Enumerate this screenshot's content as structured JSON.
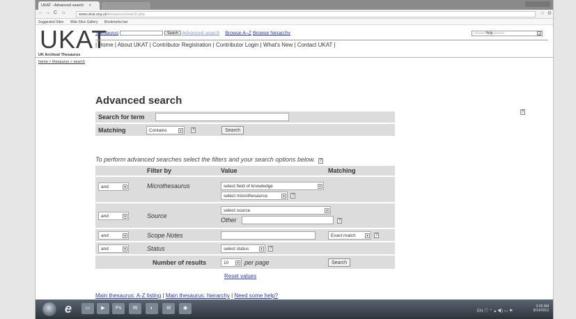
{
  "browser": {
    "tab_title": "UKAT - Advanced search",
    "tab_close": "×",
    "url_host": "www.ukat.org.uk",
    "url_path": "/thesaurus/search.php",
    "bookmarks": [
      "Suggested Sites",
      "Web Slice Gallery",
      "Bookmarks bar"
    ]
  },
  "header": {
    "logo": "UKAT",
    "logo_subtitle": "UK Archival Thesaurus",
    "thesaurus_link": "Thesaurus",
    "search_button": "Search",
    "advanced_link": "Advanced search",
    "browse_az": "Browse A–Z",
    "browse_hierarchy": "Browse hierarchy",
    "help_select": "——— Help ———",
    "menu": "| Home | About UKAT | Contributor Registration | Contributor Login | What's New | Contact UKAT |"
  },
  "breadcrumb": "home > thesaurus > search",
  "page": {
    "title": "Advanced search",
    "search_for_term_label": "Search for term",
    "matching_label": "Matching",
    "matching_value": "Contains",
    "search_button": "Search",
    "instruction": "To perform advanced searches select the filters and your search options below."
  },
  "table": {
    "headers": [
      "Filter by",
      "Value",
      "Matching"
    ],
    "rows": [
      {
        "op": "and",
        "filter": "Microthesaurus",
        "value1": "select field of knowledge",
        "value2": "select microthesaurus"
      },
      {
        "op": "and",
        "filter": "Source",
        "value1": "select source",
        "value2_label": "Other"
      },
      {
        "op": "and",
        "filter": "Scope Notes",
        "matching": "Exact match"
      },
      {
        "op": "and",
        "filter": "Status",
        "value1": "select status"
      }
    ],
    "number_of_results_label": "Number of results",
    "results_value": "10",
    "per_page": "per page",
    "search_button": "Search",
    "reset": "Reset values"
  },
  "footer": {
    "link1": "Main thesaurus: A-Z listing",
    "link2": "Main thesaurus: hierarchy",
    "link3": "Need some help?"
  },
  "taskbar": {
    "time": "3:06 AM",
    "date": "8/14/2012",
    "lang": "EN"
  },
  "icons": {
    "help": "?",
    "dropdown": "▾",
    "back": "←",
    "forward": "→",
    "reload": "C",
    "home": "⌂",
    "star": "☆",
    "wrench": "🔧"
  }
}
